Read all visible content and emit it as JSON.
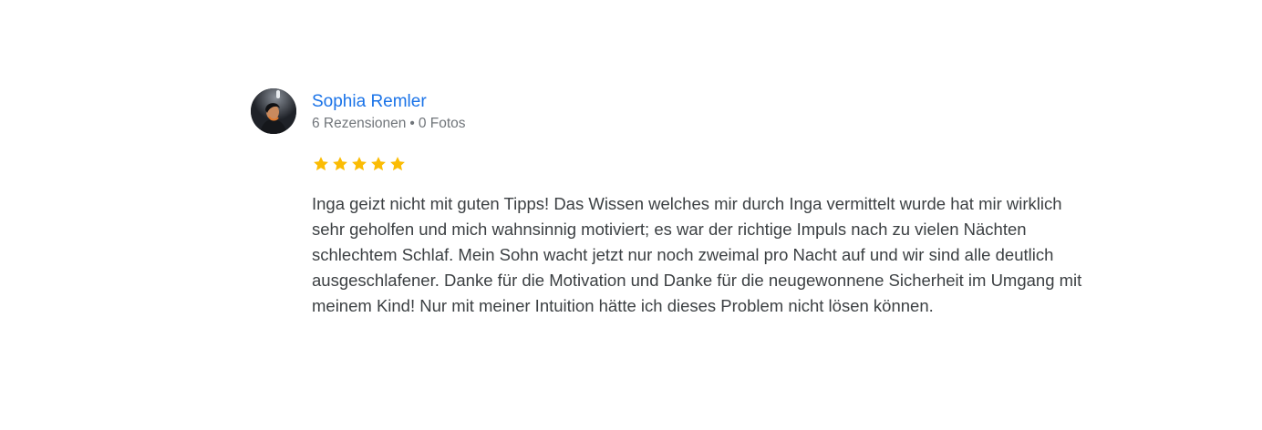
{
  "review": {
    "author_name": "Sophia Remler",
    "review_count": "6 Rezensionen",
    "separator": "•",
    "photo_count": "0 Fotos",
    "rating": 5,
    "rating_max": 5,
    "star_color": "#fbbc04",
    "name_color": "#1a73e8",
    "text": "Inga geizt nicht mit guten Tipps! Das Wissen welches mir durch Inga vermittelt wurde hat mir wirklich sehr geholfen und mich wahnsinnig motiviert; es war der richtige Impuls nach zu vielen Nächten schlechtem Schlaf. Mein Sohn wacht jetzt nur noch zweimal pro Nacht auf und wir sind alle deutlich ausgeschlafener. Danke für die Motivation und Danke für die neugewonnene Sicherheit im Umgang mit meinem Kind! Nur mit meiner Intuition hätte ich dieses Problem nicht lösen können."
  }
}
